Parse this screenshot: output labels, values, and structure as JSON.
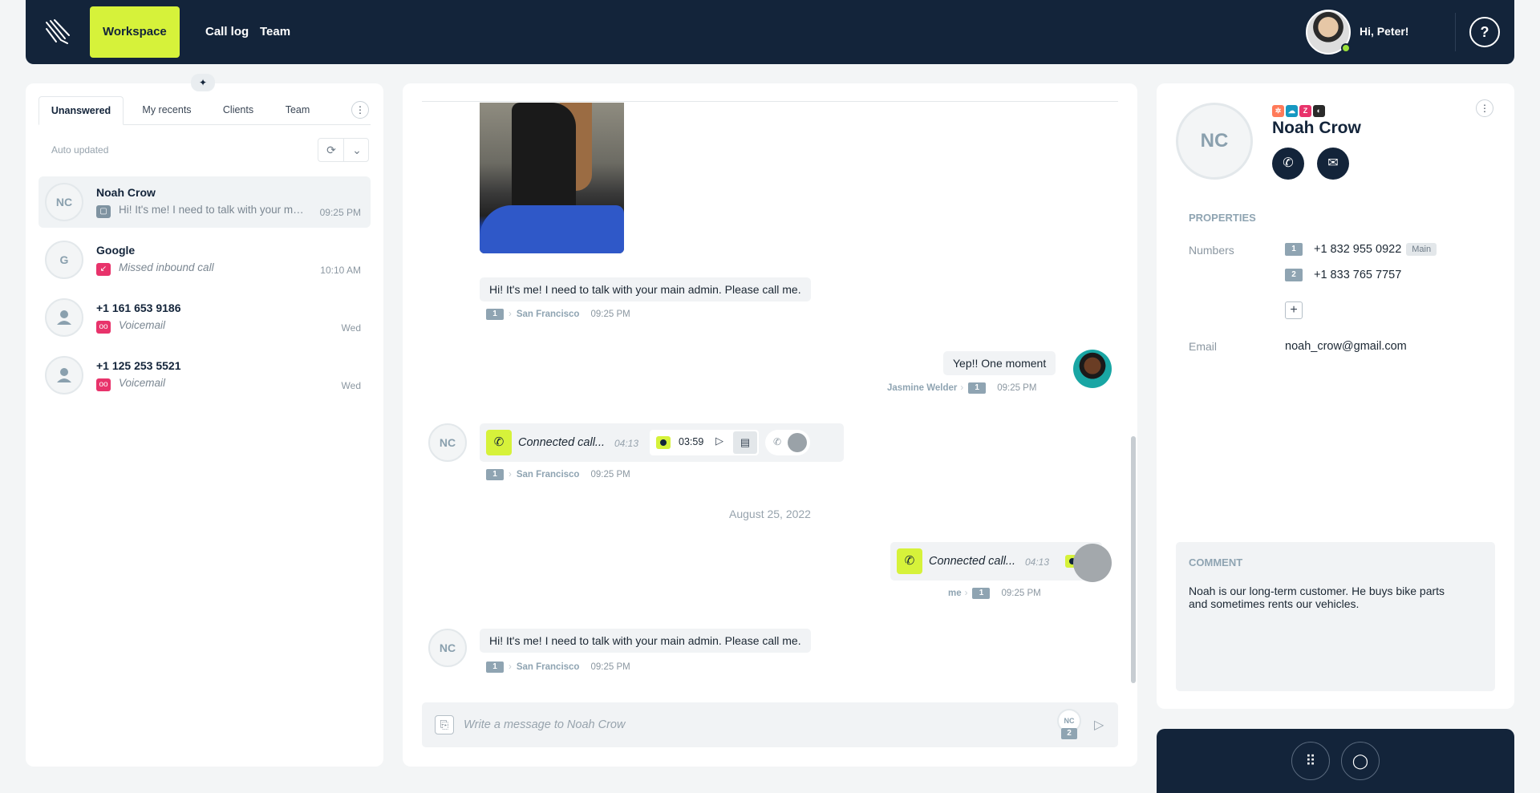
{
  "header": {
    "nav": [
      "Workspace",
      "Call log",
      "Team"
    ],
    "greeting": "Hi, Peter!",
    "help_icon": "?"
  },
  "left": {
    "tabs": [
      "Unanswered",
      "My recents",
      "Clients",
      "Team"
    ],
    "auto_updated": "Auto updated",
    "conversations": [
      {
        "initials": "NC",
        "name": "Noah Crow",
        "preview": "Hi! It's me! I need to talk with your main admin. Please call me.",
        "time": "09:25 PM",
        "icon": "message-icon"
      },
      {
        "initials": "G",
        "name": "Google",
        "preview": "Missed inbound call",
        "time": "10:10 AM",
        "icon": "missed-call-icon"
      },
      {
        "initials": "",
        "name": "+1 161 653 9186",
        "preview": "Voicemail",
        "time": "Wed",
        "icon": "voicemail-icon"
      },
      {
        "initials": "",
        "name": "+1 125 253 5521",
        "preview": "Voicemail",
        "time": "Wed",
        "icon": "voicemail-icon"
      }
    ]
  },
  "chat": {
    "messages": [
      {
        "text": "Hi! It's me! I need to talk with your main admin. Please call me.",
        "line": "1",
        "location": "San Francisco",
        "time": "09:25 PM"
      },
      {
        "text": "Yep!! One moment",
        "sender": "Jasmine Welder",
        "line": "1",
        "time": "09:25 PM"
      },
      {
        "call_text": "Connected call...",
        "duration": "04:13",
        "player_time": "03:59",
        "line": "1",
        "location": "San Francisco",
        "time": "09:25 PM"
      },
      {
        "call_text": "Connected call...",
        "duration": "04:13",
        "sender": "me",
        "line": "1",
        "time": "09:25 PM"
      },
      {
        "text": "Hi! It's me! I need to talk with your main admin. Please call me.",
        "line": "1",
        "location": "San Francisco",
        "time": "09:25 PM"
      }
    ],
    "date_separator": "August 25, 2022",
    "composer_placeholder": "Write a message to Noah Crow",
    "from_initials": "NC",
    "from_line": "2",
    "contact_initials": "NC"
  },
  "contact": {
    "initials": "NC",
    "name": "Noah Crow",
    "properties_title": "PROPERTIES",
    "numbers_label": "Numbers",
    "numbers": [
      {
        "idx": "1",
        "value": "+1 832 955 0922",
        "tag": "Main"
      },
      {
        "idx": "2",
        "value": "+1 833 765 7757",
        "tag": ""
      }
    ],
    "email_label": "Email",
    "email": "noah_crow@gmail.com",
    "comment_title": "COMMENT",
    "comment": "Noah is our long-term customer. He buys bike parts and sometimes rents our vehicles."
  },
  "colors": {
    "navy": "#13243a",
    "accent": "#d6f23a",
    "red": "#e8336b"
  }
}
